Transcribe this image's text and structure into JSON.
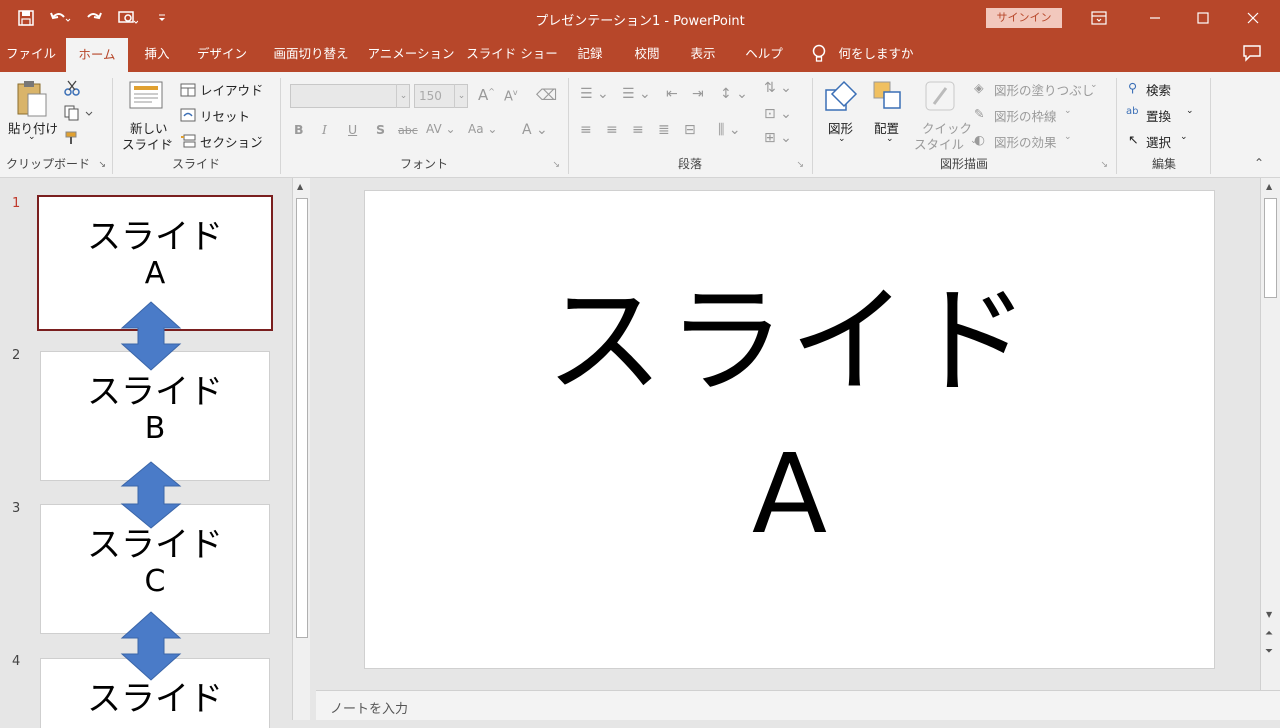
{
  "window": {
    "title": "プレゼンテーション1  -  PowerPoint",
    "signin_label": "サインイン"
  },
  "tabs": [
    {
      "label": "ファイル",
      "active": false
    },
    {
      "label": "ホーム",
      "active": true
    },
    {
      "label": "挿入",
      "active": false
    },
    {
      "label": "デザイン",
      "active": false
    },
    {
      "label": "画面切り替え",
      "active": false
    },
    {
      "label": "アニメーション",
      "active": false
    },
    {
      "label": "スライド ショー",
      "active": false
    },
    {
      "label": "記録",
      "active": false
    },
    {
      "label": "校閲",
      "active": false
    },
    {
      "label": "表示",
      "active": false
    },
    {
      "label": "ヘルプ",
      "active": false
    },
    {
      "label": "何をしますか",
      "active": false
    }
  ],
  "ribbon": {
    "clipboard": {
      "paste_label": "貼り付け",
      "group_label": "クリップボード"
    },
    "slides": {
      "new_slide_label_1": "新しい",
      "new_slide_label_2": "スライド",
      "layout_label": "レイアウト",
      "reset_label": "リセット",
      "section_label": "セクション",
      "group_label": "スライド"
    },
    "font": {
      "font_name_value": "",
      "font_size_value": "150",
      "group_label": "フォント"
    },
    "paragraph": {
      "group_label": "段落"
    },
    "drawing": {
      "shapes_label": "図形",
      "arrange_label": "配置",
      "quick_style_label_1": "クイック",
      "quick_style_label_2": "スタイル",
      "fill_label": "図形の塗りつぶし",
      "outline_label": "図形の枠線",
      "effects_label": "図形の効果",
      "group_label": "図形描画"
    },
    "editing": {
      "find_label": "検索",
      "replace_label": "置換",
      "select_label": "選択",
      "group_label": "編集"
    }
  },
  "slides": [
    {
      "number": "1",
      "line1": "スライド",
      "line2": "A"
    },
    {
      "number": "2",
      "line1": "スライド",
      "line2": "B"
    },
    {
      "number": "3",
      "line1": "スライド",
      "line2": "C"
    },
    {
      "number": "4",
      "line1": "スライド",
      "line2": ""
    }
  ],
  "current_slide": {
    "line1": "スライド",
    "line2": "A"
  },
  "notes_placeholder": "ノートを入力",
  "colors": {
    "accent": "#b7472a",
    "selected_border": "#7a1f1f",
    "arrow": "#4a7bc8"
  }
}
